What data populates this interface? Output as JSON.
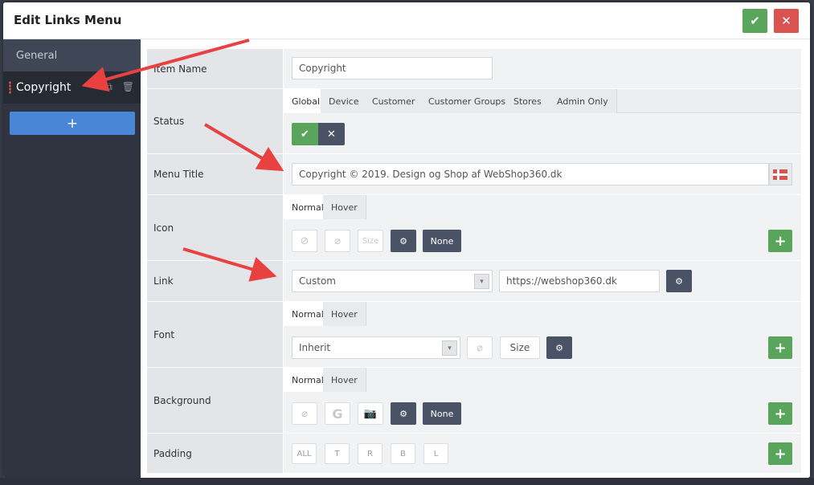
{
  "modal": {
    "title": "Edit Links Menu",
    "confirm_icon": "check-icon",
    "close_icon": "close-icon"
  },
  "sidebar": {
    "general_label": "General",
    "items": [
      {
        "label": "Copyright"
      }
    ],
    "add_label": "+"
  },
  "form": {
    "item_name": {
      "label": "Item Name",
      "value": "Copyright"
    },
    "status": {
      "label": "Status",
      "tabs": [
        "Global",
        "Device",
        "Customer",
        "Customer Groups",
        "Stores",
        "Admin Only"
      ],
      "active_tab": "Global",
      "on_glyph": "✔",
      "off_glyph": "✕"
    },
    "menu_title": {
      "label": "Menu Title",
      "value": "Copyright © 2019.  Design og Shop af WebShop360.dk"
    },
    "icon": {
      "label": "Icon",
      "tabs": [
        "Normal",
        "Hover"
      ],
      "size_label": "Size",
      "none_label": "None"
    },
    "link": {
      "label": "Link",
      "type": "Custom",
      "url": "https://webshop360.dk"
    },
    "font": {
      "label": "Font",
      "tabs": [
        "Normal",
        "Hover"
      ],
      "family": "Inherit",
      "size_label": "Size"
    },
    "background": {
      "label": "Background",
      "tabs": [
        "Normal",
        "Hover"
      ],
      "g_label": "G",
      "none_label": "None"
    },
    "padding": {
      "label": "Padding",
      "buttons": [
        "ALL",
        "T",
        "R",
        "B",
        "L"
      ]
    },
    "add_label": "+"
  },
  "colors": {
    "accent_green": "#5aa55c",
    "danger_red": "#d9534f",
    "primary_blue": "#4a86d6",
    "arrow_red": "#e8413f"
  }
}
